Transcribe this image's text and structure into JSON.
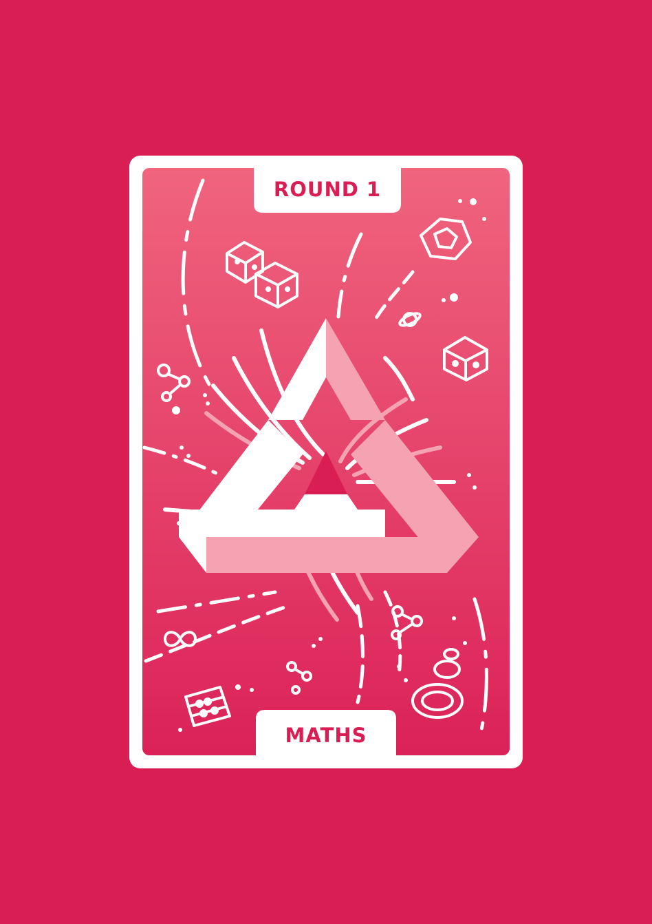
{
  "card": {
    "round_label": "ROUND 1",
    "category_label": "MATHS"
  },
  "colors": {
    "background": "#d91e54",
    "card_frame": "#ffffff",
    "card_gradient_top": "#f0647e",
    "card_gradient_bottom": "#db2258",
    "shape_light": "#f5a3b3",
    "shape_white": "#ffffff"
  },
  "icons": [
    "dice-icon",
    "dodecahedron-icon",
    "planet-icon",
    "molecule-icon",
    "infinity-icon",
    "abacus-icon",
    "coin-stack-icon",
    "impossible-triangle-icon"
  ]
}
